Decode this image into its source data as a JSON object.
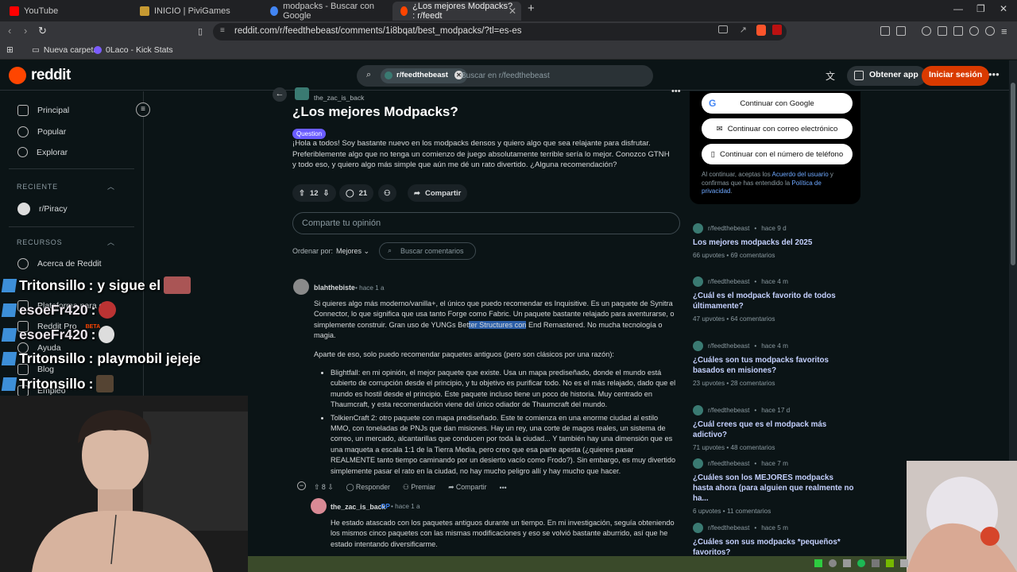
{
  "browser": {
    "tabs": [
      {
        "label": "YouTube",
        "color": "#ff0000"
      },
      {
        "label": "INICIO | PiviGames",
        "color": "#c79a32"
      },
      {
        "label": "modpacks - Buscar con Google",
        "color": "#4285f4"
      },
      {
        "label": "¿Los mejores Modpacks? : r/feedt",
        "color": "#ff4500"
      }
    ],
    "url": "reddit.com/r/feedthebeast/comments/1i8bqat/best_modpacks/?tl=es-es",
    "bookmarks": [
      "Nueva carpeta",
      "0Laco - Kick Stats"
    ]
  },
  "reddit": {
    "logo": "reddit",
    "search_chip": "r/feedthebeast",
    "search_placeholder": "Buscar en r/feedthebeast",
    "get_app": "Obtener app",
    "login": "Iniciar sesión"
  },
  "sidebar": {
    "main": [
      {
        "label": "Principal",
        "icon": "home-icon"
      },
      {
        "label": "Popular",
        "icon": "popular-icon"
      },
      {
        "label": "Explorar",
        "icon": "explore-icon"
      }
    ],
    "recent_title": "RECIENTE",
    "recent": [
      {
        "label": "r/Piracy"
      }
    ],
    "resources_title": "RECURSOS",
    "resources": [
      {
        "label": "Acerca de Reddit"
      },
      {
        "label": "Plataforma para de"
      },
      {
        "label": "Reddit Pro",
        "badge": "BETA"
      },
      {
        "label": "Ayuda"
      },
      {
        "label": "Blog"
      },
      {
        "label": "Empleo"
      }
    ]
  },
  "post": {
    "author": "the_zac_is_back",
    "title": "¿Los mejores Modpacks?",
    "flair": "Question",
    "body": "¡Hola a todos! Soy bastante nuevo en los modpacks densos y quiero algo que sea relajante para disfrutar. Preferiblemente algo que no tenga un comienzo de juego absolutamente terrible sería lo mejor. Conozco GTNH y todo eso, y quiero algo más simple que aún me dé un rato divertido. ¿Alguna recomendación?",
    "votes": "12",
    "comments": "21",
    "share": "Compartir",
    "comment_placeholder": "Comparte tu opinión",
    "sort_label": "Ordenar por:",
    "sort_value": "Mejores",
    "search_comments": "Buscar comentarios"
  },
  "comments": [
    {
      "author": "blahthebiste",
      "time": "hace 1 a",
      "p1_a": "Si quieres algo más moderno/vanilla+, el único que puedo recomendar es Inquisitive. Es un paquete de Synitra Connector, lo que significa que usa tanto Forge como Fabric. Un paquete bastante relajado para aventurarse, o simplemente construir. Gran uso de YUNGs Bet",
      "p1_hl": "ter Structures con",
      "p1_b": " End Remastered. No mucha tecnología o magia.",
      "p2": "Aparte de eso, solo puedo recomendar paquetes antiguos (pero son clásicos por una razón):",
      "bullets": [
        "Blightfall: en mi opinión, el mejor paquete que existe. Usa un mapa prediseñado, donde el mundo está cubierto de corrupción desde el principio, y tu objetivo es purificar todo. No es el más relajado, dado que el mundo es hostil desde el principio. Este paquete incluso tiene un poco de historia. Muy centrado en Thaumcraft, y esta recomendación viene del único odiador de Thaumcraft del mundo.",
        "TolkienCraft 2: otro paquete con mapa prediseñado. Este te comienza en una enorme ciudad al estilo MMO, con toneladas de PNJs que dan misiones. Hay un rey, una corte de magos reales, un sistema de correo, un mercado, alcantarillas que conducen por toda la ciudad... Y también hay una dimensión que es una maqueta a escala 1:1 de la Tierra Media, pero creo que esa parte apesta (¿quieres pasar REALMENTE tanto tiempo caminando por un desierto vacío como Frodo?). Sin embargo, es muy divertido simplemente pasar el rato en la ciudad, no hay mucho peligro allí y hay mucho que hacer."
      ],
      "votes": "8",
      "reply": "Responder",
      "award": "Premiar",
      "share": "Compartir"
    },
    {
      "author": "the_zac_is_back",
      "op": "OP",
      "time": "hace 1 a",
      "text": "He estado atascado con los paquetes antiguos durante un tiempo. En mi investigación, seguía obteniendo los mismos cinco paquetes con las mismas modificaciones y eso se volvió bastante aburrido, así que he estado intentando diversificarme."
    }
  ],
  "login_box": {
    "google": "Continuar con Google",
    "email": "Continuar con correo electrónico",
    "phone": "Continuar con el número de teléfono",
    "legal_a": "Al continuar, aceptas los ",
    "legal_link1": "Acuerdo del usuario",
    "legal_b": " y confirmas que has entendido la ",
    "legal_link2": "Política de privacidad",
    "legal_c": "."
  },
  "related": [
    {
      "sub": "r/feedthebeast",
      "time": "hace 9 d",
      "title": "Los mejores modpacks del 2025",
      "upvotes": "66 upvotes",
      "comments": "69 comentarios"
    },
    {
      "sub": "r/feedthebeast",
      "time": "hace 4 m",
      "title": "¿Cuál es el modpack favorito de todos últimamente?",
      "upvotes": "47 upvotes",
      "comments": "64 comentarios"
    },
    {
      "sub": "r/feedthebeast",
      "time": "hace 4 m",
      "title": "¿Cuáles son tus modpacks favoritos basados en misiones?",
      "upvotes": "23 upvotes",
      "comments": "28 comentarios"
    },
    {
      "sub": "r/feedthebeast",
      "time": "hace 17 d",
      "title": "¿Cuál crees que es el modpack más adictivo?",
      "upvotes": "71 upvotes",
      "comments": "48 comentarios"
    },
    {
      "sub": "r/feedthebeast",
      "time": "hace 7 m",
      "title": "¿Cuáles son los MEJORES modpacks hasta ahora (para alguien que realmente no ha...",
      "upvotes": "6 upvotes",
      "comments": "11 comentarios"
    },
    {
      "sub": "r/feedthebeast",
      "time": "hace 5 m",
      "title": "¿Cuáles son sus modpacks *pequeños* favoritos?",
      "upvotes": "",
      "comments": ""
    }
  ],
  "overlay_chat": [
    {
      "user": "Tritonsillo",
      "msg": ": y sigue el"
    },
    {
      "user": "esoeFr420",
      "msg": ":"
    },
    {
      "user": "esoeFr420",
      "msg": ":"
    },
    {
      "user": "Tritonsillo",
      "msg": ": playmobil jejeje"
    },
    {
      "user": "Tritonsillo",
      "msg": ":"
    }
  ],
  "colors": {
    "accent": "#ff4500",
    "link": "#6ea8ff",
    "bg": "#0b1416"
  }
}
